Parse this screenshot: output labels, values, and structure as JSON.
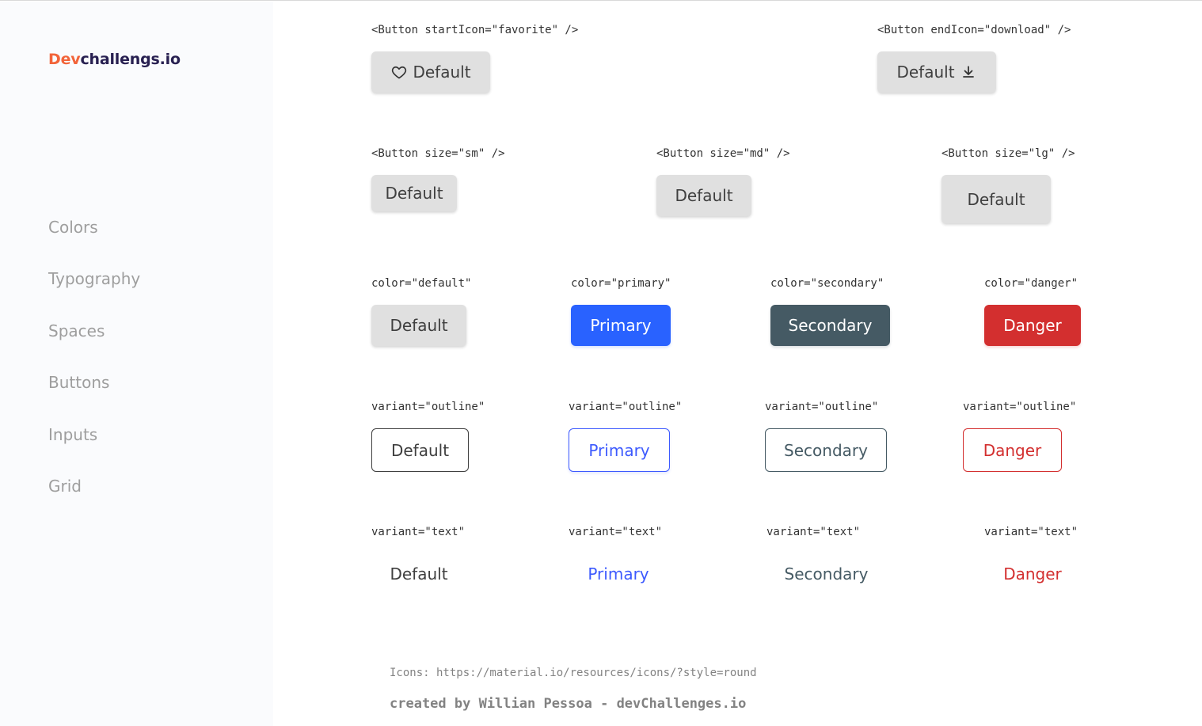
{
  "sidebar": {
    "logo_prefix": "Dev",
    "logo_suffix": "challengs.io",
    "items": [
      {
        "label": "Colors"
      },
      {
        "label": "Typography"
      },
      {
        "label": "Spaces"
      },
      {
        "label": "Buttons"
      },
      {
        "label": "Inputs"
      },
      {
        "label": "Grid"
      }
    ]
  },
  "icons_row": {
    "start": {
      "code": "<Button startIcon=\"favorite\" />",
      "button": "Default",
      "icon": "favorite-icon"
    },
    "end": {
      "code": "<Button endIcon=\"download\" />",
      "button": "Default",
      "icon": "download-icon"
    }
  },
  "sizes_row": [
    {
      "code": "<Button size=\"sm\" />",
      "button": "Default"
    },
    {
      "code": "<Button size=\"md\" />",
      "button": "Default"
    },
    {
      "code": "<Button size=\"lg\" />",
      "button": "Default"
    }
  ],
  "colors_row": [
    {
      "code": "color=\"default\"",
      "button": "Default"
    },
    {
      "code": "color=\"primary\"",
      "button": "Primary"
    },
    {
      "code": "color=\"secondary\"",
      "button": "Secondary"
    },
    {
      "code": "color=\"danger\"",
      "button": "Danger"
    }
  ],
  "outline_row": [
    {
      "code": "variant=\"outline\"",
      "button": "Default"
    },
    {
      "code": "variant=\"outline\"",
      "button": "Primary"
    },
    {
      "code": "variant=\"outline\"",
      "button": "Secondary"
    },
    {
      "code": "variant=\"outline\"",
      "button": "Danger"
    }
  ],
  "text_row": [
    {
      "code": "variant=\"text\"",
      "button": "Default"
    },
    {
      "code": "variant=\"text\"",
      "button": "Primary"
    },
    {
      "code": "variant=\"text\"",
      "button": "Secondary"
    },
    {
      "code": "variant=\"text\"",
      "button": "Danger"
    }
  ],
  "footer": {
    "icons_note": "Icons: https://material.io/resources/icons/?style=round",
    "credit": "created by Willian Pessoa - devChallenges.io"
  },
  "colors": {
    "default": "#e0e0e0",
    "primary": "#2962ff",
    "secondary": "#455a64",
    "danger": "#d32f2f",
    "logo_accent": "#f2643a",
    "logo_text": "#282051"
  }
}
